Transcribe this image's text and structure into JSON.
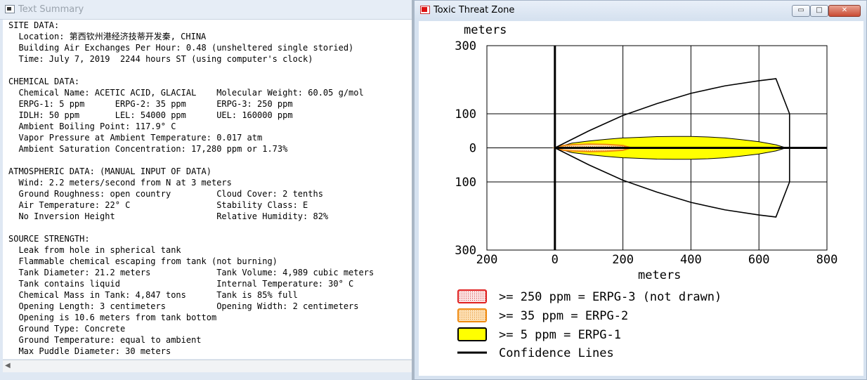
{
  "left_window": {
    "title": "Text Summary",
    "summary_lines": [
      "SITE DATA:",
      "  Location: 第西钦州港经济技蒂开发秦, CHINA",
      "  Building Air Exchanges Per Hour: 0.48 (unsheltered single storied)",
      "  Time: July 7, 2019  2244 hours ST (using computer's clock)",
      "",
      "CHEMICAL DATA:",
      "  Chemical Name: ACETIC ACID, GLACIAL    Molecular Weight: 60.05 g/mol",
      "  ERPG-1: 5 ppm      ERPG-2: 35 ppm      ERPG-3: 250 ppm",
      "  IDLH: 50 ppm       LEL: 54000 ppm      UEL: 160000 ppm",
      "  Ambient Boiling Point: 117.9° C",
      "  Vapor Pressure at Ambient Temperature: 0.017 atm",
      "  Ambient Saturation Concentration: 17,280 ppm or 1.73%",
      "",
      "ATMOSPHERIC DATA: (MANUAL INPUT OF DATA)",
      "  Wind: 2.2 meters/second from N at 3 meters",
      "  Ground Roughness: open country         Cloud Cover: 2 tenths",
      "  Air Temperature: 22° C                 Stability Class: E",
      "  No Inversion Height                    Relative Humidity: 82%",
      "",
      "SOURCE STRENGTH:",
      "  Leak from hole in spherical tank",
      "  Flammable chemical escaping from tank (not burning)",
      "  Tank Diameter: 21.2 meters             Tank Volume: 4,989 cubic meters",
      "  Tank contains liquid                   Internal Temperature: 30° C",
      "  Chemical Mass in Tank: 4,847 tons      Tank is 85% full",
      "  Opening Length: 3 centimeters          Opening Width: 2 centimeters",
      "  Opening is 10.6 meters from tank bottom",
      "  Ground Type: Concrete",
      "  Ground Temperature: equal to ambient",
      "  Max Puddle Diameter: 30 meters"
    ]
  },
  "right_window": {
    "title": "Toxic Threat Zone",
    "controls": {
      "minimize": "▭",
      "maximize": "□",
      "close": "✕"
    }
  },
  "chart_data": {
    "type": "area",
    "xlabel": "meters",
    "ylabel": "meters",
    "xlim": [
      -200,
      800
    ],
    "ylim": [
      -300,
      300
    ],
    "x_ticks": [
      -200,
      0,
      200,
      400,
      600,
      800
    ],
    "x_tick_labels": [
      "200",
      "0",
      "200",
      "400",
      "600",
      "800"
    ],
    "y_ticks": [
      300,
      100,
      0,
      -100,
      -300
    ],
    "y_tick_labels": [
      "300",
      "100",
      "0",
      "100",
      "300"
    ],
    "grid": true,
    "legend": [
      {
        "label": ">= 250 ppm = ERPG-3 (not drawn)",
        "color": "#e02020",
        "fill": "#f6dede",
        "dotted": true
      },
      {
        "label": ">= 35 ppm = ERPG-2",
        "color": "#f08a10",
        "fill": "#f7ddb0",
        "dotted": true
      },
      {
        "label": ">= 5 ppm = ERPG-1",
        "color": "#000000",
        "fill": "#ffff00",
        "dotted": false
      },
      {
        "label": "Confidence Lines",
        "color": "#000000",
        "line": true
      }
    ],
    "series": [
      {
        "name": "ERPG-1",
        "color": "#ffff00",
        "x": [
          0,
          50,
          100,
          150,
          200,
          250,
          300,
          350,
          400,
          450,
          500,
          550,
          600,
          650,
          680
        ],
        "y_half_width": [
          0,
          14,
          20,
          25,
          29,
          31,
          33,
          33.5,
          33.5,
          32,
          29,
          24,
          18,
          9,
          0
        ]
      },
      {
        "name": "ERPG-2",
        "color": "#f08a10",
        "x": [
          0,
          25,
          50,
          100,
          150,
          200,
          225
        ],
        "y_half_width": [
          0,
          7,
          9,
          11,
          10,
          7,
          0
        ]
      },
      {
        "name": "Confidence Lines",
        "color": "#000000",
        "x": [
          0,
          100,
          200,
          300,
          400,
          500,
          600,
          650,
          690,
          690,
          650,
          600,
          500,
          400,
          300,
          200,
          100,
          0
        ],
        "y": [
          0,
          50,
          95,
          130,
          160,
          182,
          197,
          203,
          100,
          -100,
          -203,
          -197,
          -182,
          -160,
          -130,
          -95,
          -50,
          0
        ]
      }
    ]
  }
}
